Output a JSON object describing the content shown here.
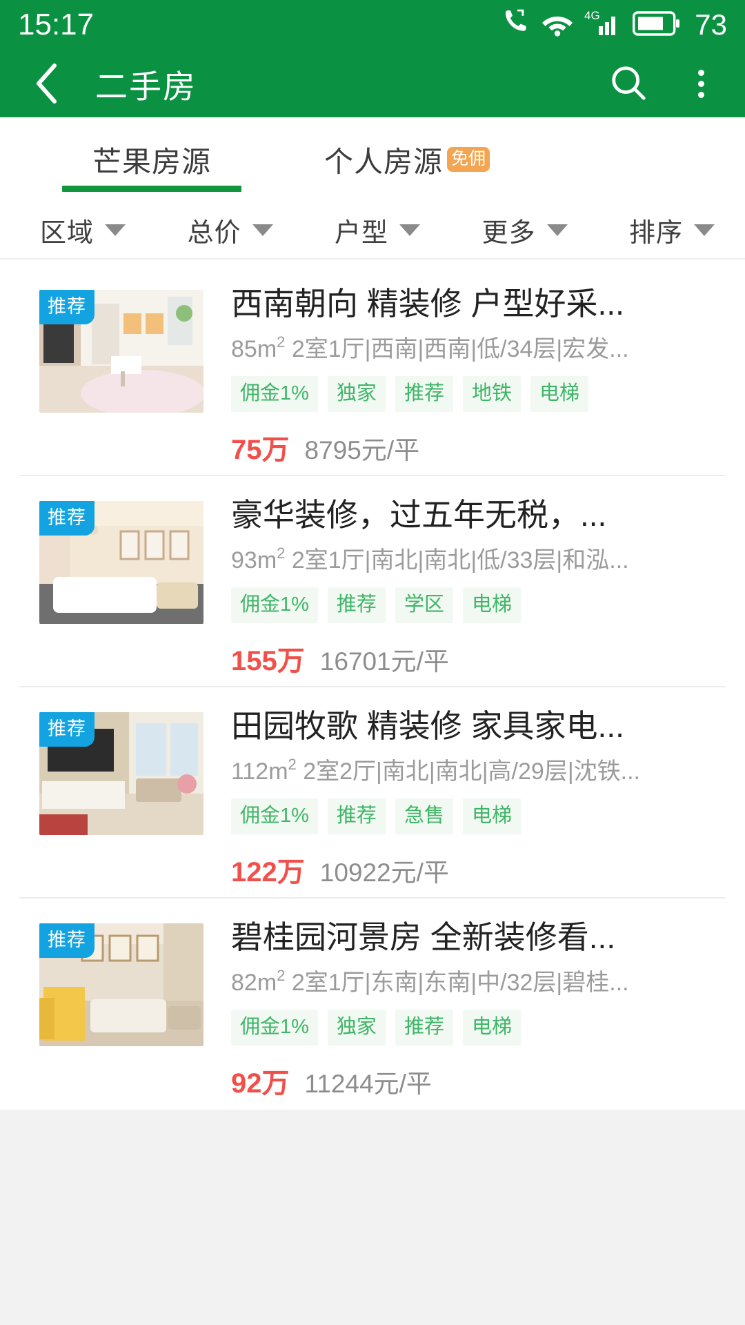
{
  "status_bar": {
    "time": "15:17",
    "battery_level": "73",
    "icons": [
      "call-forward-icon",
      "wifi-icon",
      "signal-4g-icon",
      "battery-icon"
    ],
    "network": "4G"
  },
  "app_bar": {
    "back_label": "back-arrow",
    "title": "二手房",
    "search_label": "search-icon",
    "menu_label": "overflow-menu-icon"
  },
  "tabs": [
    {
      "label": "芒果房源",
      "active": true,
      "badge": ""
    },
    {
      "label": "个人房源",
      "active": false,
      "badge": "免佣"
    }
  ],
  "filters": [
    {
      "label": "区域"
    },
    {
      "label": "总价"
    },
    {
      "label": "户型"
    },
    {
      "label": "更多"
    },
    {
      "label": "排序"
    }
  ],
  "listings": [
    {
      "badge": "推荐",
      "title": "西南朝向 精装修 户型好采...",
      "area": "85",
      "detail": " 2室1厅|西南|西南|低/34层|宏发...",
      "tags": [
        "佣金1%",
        "独家",
        "推荐",
        "地铁",
        "电梯"
      ],
      "price": "75万",
      "unit_price": "8795元/平"
    },
    {
      "badge": "推荐",
      "title": "豪华装修，过五年无税，...",
      "area": "93",
      "detail": " 2室1厅|南北|南北|低/33层|和泓...",
      "tags": [
        "佣金1%",
        "推荐",
        "学区",
        "电梯"
      ],
      "price": "155万",
      "unit_price": "16701元/平"
    },
    {
      "badge": "推荐",
      "title": "田园牧歌 精装修 家具家电...",
      "area": "112",
      "detail": " 2室2厅|南北|南北|高/29层|沈铁...",
      "tags": [
        "佣金1%",
        "推荐",
        "急售",
        "电梯"
      ],
      "price": "122万",
      "unit_price": "10922元/平"
    },
    {
      "badge": "推荐",
      "title": "碧桂园河景房 全新装修看...",
      "area": "82",
      "detail": " 2室1厅|东南|东南|中/32层|碧桂...",
      "tags": [
        "佣金1%",
        "独家",
        "推荐",
        "电梯"
      ],
      "price": "92万",
      "unit_price": "11244元/平"
    }
  ],
  "colors": {
    "brand_green": "#0a9141",
    "tab_underline": "#13963f",
    "badge_blue": "#12a3e0",
    "badge_orange": "#f4a552",
    "price_red": "#f1504a",
    "tag_green": "#3fb567",
    "tag_bg": "#f1f9f2"
  }
}
